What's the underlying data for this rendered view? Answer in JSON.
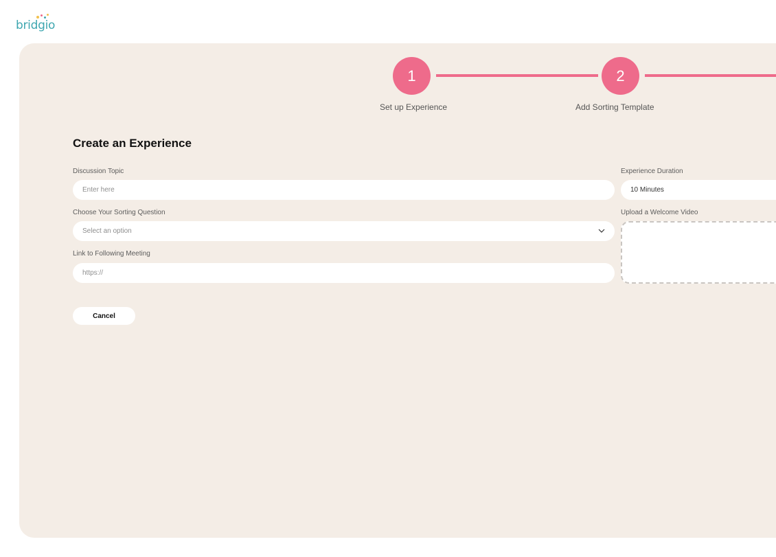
{
  "brand": {
    "logo_text": "bridgio"
  },
  "stepper": {
    "accent_color": "#ee6b8b",
    "steps": [
      {
        "number": "1",
        "label": "Set up Experience"
      },
      {
        "number": "2",
        "label": "Add Sorting Template"
      }
    ]
  },
  "form": {
    "title": "Create an Experience",
    "discussion_topic": {
      "label": "Discussion Topic",
      "placeholder": "Enter here"
    },
    "sorting_question": {
      "label": "Choose Your Sorting Question",
      "placeholder": "Select an option"
    },
    "following_meeting": {
      "label": "Link to Following Meeting",
      "placeholder": "https://"
    },
    "experience_duration": {
      "label": "Experience Duration",
      "value": "10 Minutes"
    },
    "welcome_video": {
      "label": "Upload a Welcome Video"
    }
  },
  "actions": {
    "cancel_label": "Cancel"
  },
  "colors": {
    "panel_bg": "#f4ede6",
    "accent": "#ee6b8b",
    "logo": "#3fa7b0"
  }
}
